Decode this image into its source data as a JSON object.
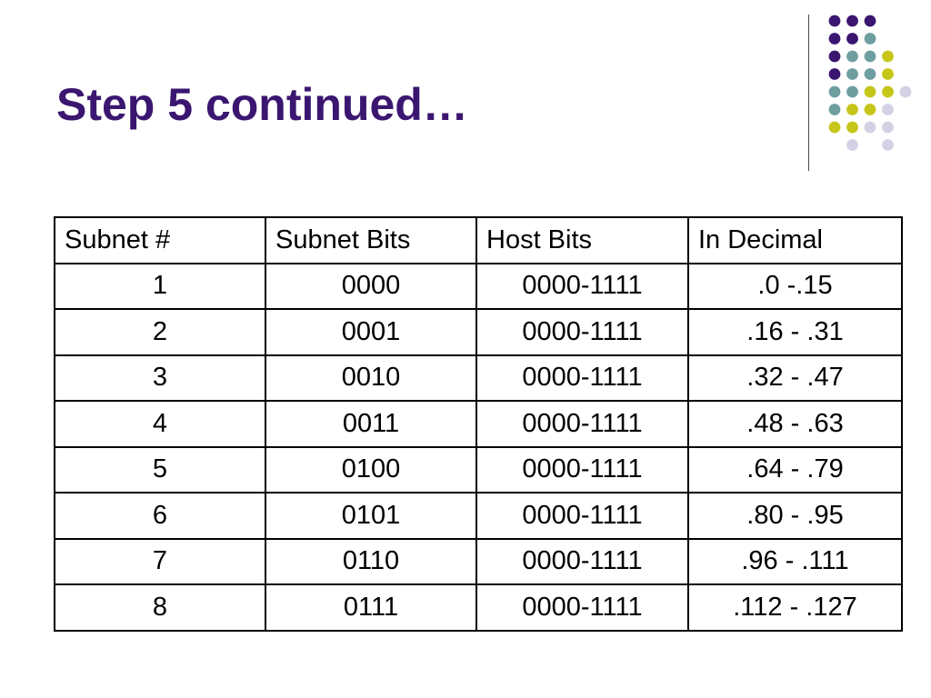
{
  "slide": {
    "title": "Step 5 continued…"
  },
  "decoration": {
    "colors": {
      "purple": "#3b1670",
      "teal": "#6f9ea0",
      "yellow": "#c6c61a",
      "lavender": "#d3d1e5"
    },
    "dot_grid": [
      [
        "purple",
        "purple",
        "purple",
        null
      ],
      [
        "purple",
        "purple",
        "teal",
        null
      ],
      [
        "purple",
        "teal",
        "teal",
        "yellow"
      ],
      [
        "purple",
        "teal",
        "teal",
        "yellow"
      ],
      [
        "teal",
        "teal",
        "yellow",
        "yellow",
        "lavender"
      ],
      [
        "teal",
        "yellow",
        "yellow",
        "lavender"
      ],
      [
        "yellow",
        "yellow",
        "lavender",
        "lavender"
      ],
      [
        null,
        "lavender",
        null,
        "lavender"
      ]
    ]
  },
  "table": {
    "headers": [
      "Subnet #",
      "Subnet Bits",
      "Host Bits",
      "In Decimal"
    ],
    "rows": [
      [
        "1",
        "0000",
        "0000-1111",
        ".0 -.15"
      ],
      [
        "2",
        "0001",
        "0000-1111",
        ".16 - .31"
      ],
      [
        "3",
        "0010",
        "0000-1111",
        ".32 - .47"
      ],
      [
        "4",
        "0011",
        "0000-1111",
        ".48 - .63"
      ],
      [
        "5",
        "0100",
        "0000-1111",
        ".64 - .79"
      ],
      [
        "6",
        "0101",
        "0000-1111",
        ".80 - .95"
      ],
      [
        "7",
        "0110",
        "0000-1111",
        ".96 - .111"
      ],
      [
        "8",
        "0111",
        "0000-1111",
        ".112 - .127"
      ]
    ]
  }
}
